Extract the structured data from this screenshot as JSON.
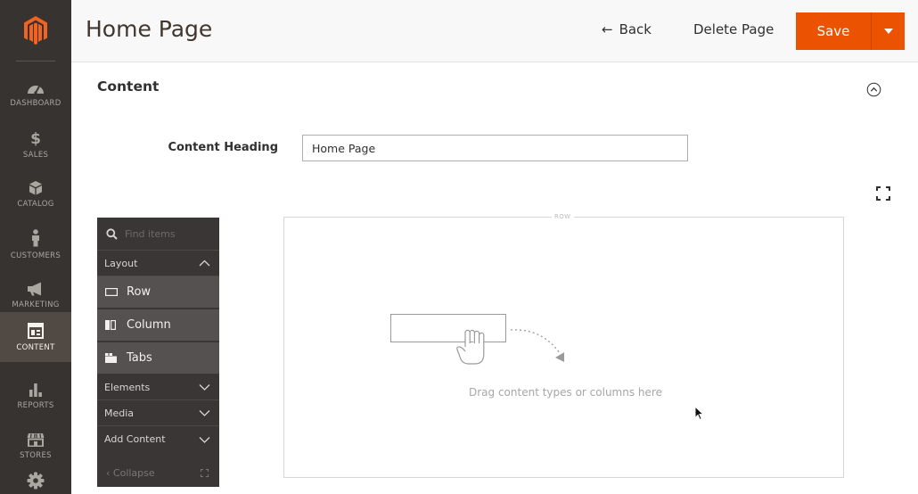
{
  "nav": {
    "items": [
      {
        "label": "DASHBOARD",
        "icon": "dashboard-icon"
      },
      {
        "label": "SALES",
        "icon": "dollar-icon"
      },
      {
        "label": "CATALOG",
        "icon": "box-icon"
      },
      {
        "label": "CUSTOMERS",
        "icon": "person-icon"
      },
      {
        "label": "MARKETING",
        "icon": "megaphone-icon"
      },
      {
        "label": "CONTENT",
        "icon": "layout-icon",
        "active": true
      },
      {
        "label": "REPORTS",
        "icon": "bar-chart-icon"
      },
      {
        "label": "STORES",
        "icon": "store-icon"
      }
    ]
  },
  "header": {
    "title": "Home Page",
    "back_label": "Back",
    "delete_label": "Delete Page",
    "save_label": "Save"
  },
  "content": {
    "section_title": "Content",
    "heading_label": "Content Heading",
    "heading_value": "Home Page"
  },
  "panel": {
    "search_placeholder": "Find items",
    "groups": [
      {
        "label": "Layout",
        "expanded": true
      },
      {
        "label": "Elements",
        "expanded": false
      },
      {
        "label": "Media",
        "expanded": false
      },
      {
        "label": "Add Content",
        "expanded": false
      }
    ],
    "layout_items": [
      {
        "label": "Row",
        "icon": "row-icon"
      },
      {
        "label": "Column",
        "icon": "column-icon"
      },
      {
        "label": "Tabs",
        "icon": "tabs-icon"
      }
    ],
    "collapse_label": "Collapse"
  },
  "stage": {
    "row_tag": "ROW",
    "drop_hint": "Drag content types or columns here"
  },
  "colors": {
    "accent": "#eb5202",
    "nav_bg": "#373330",
    "nav_active": "#514943",
    "panel_bg": "#3a3635",
    "panel_item_bg": "#555150"
  }
}
